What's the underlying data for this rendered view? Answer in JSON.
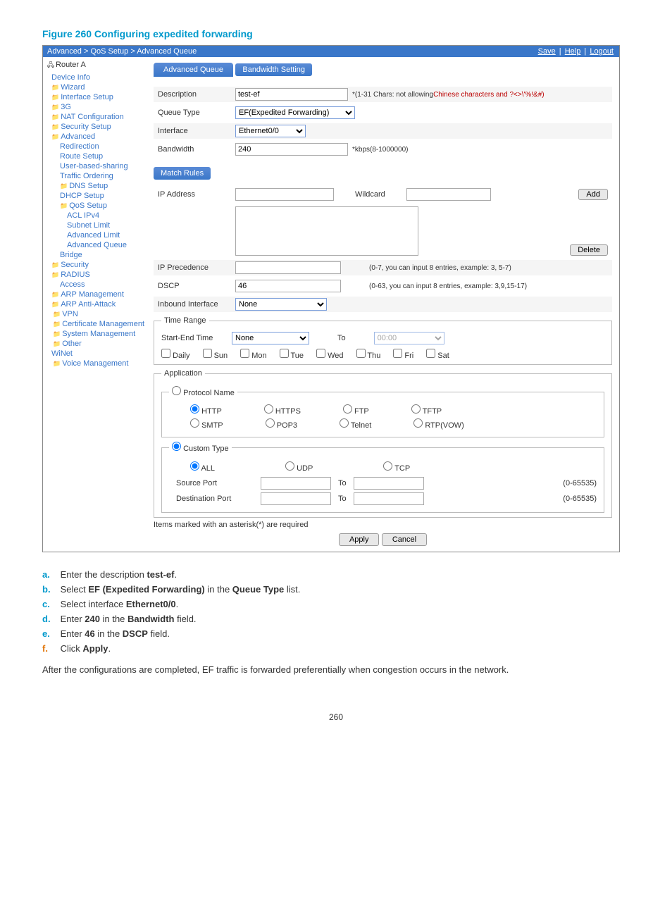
{
  "figure_title": "Figure 260 Configuring expedited forwarding",
  "breadcrumb": "Advanced > QoS Setup > Advanced Queue",
  "header_links": {
    "save": "Save",
    "help": "Help",
    "logout": "Logout"
  },
  "sidebar": {
    "root": "Router A",
    "items": [
      "Device Info",
      "Wizard",
      "Interface Setup",
      "3G",
      "NAT Configuration",
      "Security Setup",
      "Advanced",
      "Redirection",
      "Route Setup",
      "User-based-sharing",
      "Traffic Ordering",
      "DNS Setup",
      "DHCP Setup",
      "QoS Setup",
      "ACL IPv4",
      "Subnet Limit",
      "Advanced Limit",
      "Advanced Queue",
      "Bridge",
      "Security",
      "RADIUS",
      "Access",
      "ARP Management",
      "ARP Anti-Attack",
      "VPN",
      "Certificate Management",
      "System Management",
      "Other",
      "WiNet",
      "Voice Management"
    ]
  },
  "tab_label": "Advanced Queue",
  "sections": {
    "bandwidth": "Bandwidth Setting",
    "match": "Match Rules"
  },
  "form": {
    "description_label": "Description",
    "description_value": "test-ef",
    "description_hint_a": "*(1-31 Chars: not allowing",
    "description_hint_b": "Chinese characters and ?<>\\'%!&#)",
    "queue_type_label": "Queue Type",
    "queue_type_value": "EF(Expedited Forwarding)",
    "interface_label": "Interface",
    "interface_value": "Ethernet0/0",
    "bandwidth_label": "Bandwidth",
    "bandwidth_value": "240",
    "bandwidth_hint": "*kbps(8-1000000)",
    "ip_label": "IP Address",
    "wildcard": "Wildcard",
    "add_btn": "Add",
    "delete_btn": "Delete",
    "precedence_label": "IP Precedence",
    "precedence_hint": "(0-7, you can input 8 entries, example: 3, 5-7)",
    "dscp_label": "DSCP",
    "dscp_value": "46",
    "dscp_hint": "(0-63, you can input 8 entries, example: 3,9,15-17)",
    "inbound_label": "Inbound Interface",
    "inbound_value": "None",
    "timerange_legend": "Time Range",
    "start_end_label": "Start-End Time",
    "start_end_value": "None",
    "to": "To",
    "end_time": "00:00",
    "daily": "Daily",
    "days": [
      "Sun",
      "Mon",
      "Tue",
      "Wed",
      "Thu",
      "Fri",
      "Sat"
    ],
    "app_legend": "Application",
    "proto_legend": "Protocol Name",
    "protos": {
      "http": "HTTP",
      "https": "HTTPS",
      "ftp": "FTP",
      "tftp": "TFTP",
      "smtp": "SMTP",
      "pop3": "POP3",
      "telnet": "Telnet",
      "rtp": "RTP(VOW)"
    },
    "custom_legend": "Custom Type",
    "all": "ALL",
    "udp": "UDP",
    "tcp": "TCP",
    "src_port": "Source Port",
    "dst_port": "Destination Port",
    "port_range": "(0-65535)",
    "marked_hint": "Items marked with an asterisk(*) are required",
    "apply": "Apply",
    "cancel": "Cancel"
  },
  "instructions": {
    "a": "Enter the description test-ef.",
    "b": "Select EF (Expedited Forwarding) in the Queue Type list.",
    "c": "Select interface Ethernet0/0.",
    "d": "Enter 240 in the Bandwidth field.",
    "e": "Enter 46 in the DSCP field.",
    "f": "Click Apply."
  },
  "after_text": "After the configurations are completed, EF traffic is forwarded preferentially when congestion occurs in the network.",
  "page_number": "260"
}
